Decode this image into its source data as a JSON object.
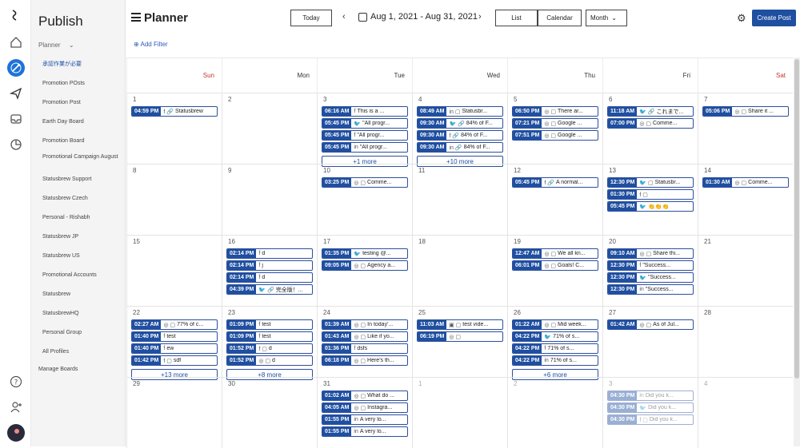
{
  "sidebar": {
    "title": "Publish",
    "section": "Planner",
    "items": [
      "承認作業が必要",
      "Promotion POsts",
      "Promotion Post",
      "Earth Day Board",
      "Promotion Board",
      "Promotional Campaign August",
      "Statusbrew Support",
      "Statusbrew Czech",
      "Personal - Rishabh",
      "Statusbrew JP",
      "Statusbrew US",
      "Promotional Accounts",
      "Statusbrew",
      "StatusbrewHQ",
      "Personal Group",
      "All Profiles"
    ],
    "manage": "Manage Boards"
  },
  "header": {
    "title": "Planner",
    "today": "Today",
    "range": "Aug 1, 2021 - Aug 31, 2021",
    "list": "List",
    "calendar": "Calendar",
    "month": "Month",
    "create": "Create Post",
    "add_filter": "Add Filter"
  },
  "days": [
    "Sun",
    "Mon",
    "Tue",
    "Wed",
    "Thu",
    "Fri",
    "Sat"
  ],
  "weeks": [
    {
      "nums": [
        "1",
        "2",
        "3",
        "4",
        "5",
        "6",
        "7"
      ],
      "cells": [
        {
          "posts": [
            {
              "t": "04:59 PM",
              "i": "f 🔗",
              "x": "Statusbrew"
            }
          ]
        },
        {
          "posts": []
        },
        {
          "posts": [
            {
              "t": "06:16 AM",
              "i": "f",
              "x": "This is a ..."
            },
            {
              "t": "05:45 PM",
              "i": "🐦",
              "x": "\"All progr..."
            },
            {
              "t": "05:45 PM",
              "i": "f",
              "x": "\"All progr..."
            },
            {
              "t": "05:45 PM",
              "i": "in",
              "x": "\"All progr..."
            }
          ],
          "more": "+1 more"
        },
        {
          "posts": [
            {
              "t": "08:49 AM",
              "i": "in ▢",
              "x": "Statusbr..."
            },
            {
              "t": "09:30 AM",
              "i": "🐦 🔗",
              "x": "84% of F..."
            },
            {
              "t": "09:30 AM",
              "i": "f 🔗",
              "x": "84% of F..."
            },
            {
              "t": "09:30 AM",
              "i": "in 🔗",
              "x": "84% of F..."
            }
          ],
          "more": "+10 more"
        },
        {
          "posts": [
            {
              "t": "06:50 PM",
              "i": "◎ ▢",
              "x": "There ar..."
            },
            {
              "t": "07:21 PM",
              "i": "◎ ▢",
              "x": "Google ..."
            },
            {
              "t": "07:51 PM",
              "i": "◎ ▢",
              "x": "Google ..."
            }
          ]
        },
        {
          "posts": [
            {
              "t": "11:18 AM",
              "i": "🐦 🔗",
              "x": "これまで..."
            },
            {
              "t": "07:00 PM",
              "i": "◎ ▢",
              "x": "Comme..."
            }
          ]
        },
        {
          "posts": [
            {
              "t": "05:06 PM",
              "i": "◎ ▢",
              "x": "Share it ..."
            }
          ]
        }
      ]
    },
    {
      "nums": [
        "8",
        "9",
        "10",
        "11",
        "12",
        "13",
        "14"
      ],
      "cells": [
        {
          "posts": []
        },
        {
          "posts": []
        },
        {
          "posts": [
            {
              "t": "03:25 PM",
              "i": "◎ ▢",
              "x": "Comme..."
            }
          ]
        },
        {
          "posts": []
        },
        {
          "posts": [
            {
              "t": "05:45 PM",
              "i": "f 🔗",
              "x": "A normal..."
            }
          ]
        },
        {
          "posts": [
            {
              "t": "12:30 PM",
              "i": "🐦 ▢",
              "x": "Statusbr..."
            },
            {
              "t": "01:30 PM",
              "i": "f ▢",
              "x": ""
            },
            {
              "t": "05:45 PM",
              "i": "🐦",
              "x": "👏👏👏"
            }
          ]
        },
        {
          "posts": [
            {
              "t": "01:30 AM",
              "i": "◎ ▢",
              "x": "Comme..."
            }
          ]
        }
      ]
    },
    {
      "nums": [
        "15",
        "16",
        "17",
        "18",
        "19",
        "20",
        "21"
      ],
      "cells": [
        {
          "posts": []
        },
        {
          "posts": [
            {
              "t": "02:14 PM",
              "i": "f",
              "x": "d"
            },
            {
              "t": "02:14 PM",
              "i": "f",
              "x": "j"
            },
            {
              "t": "02:14 PM",
              "i": "f",
              "x": "d"
            },
            {
              "t": "04:39 PM",
              "i": "🐦 🔗",
              "x": "完全版！..."
            }
          ]
        },
        {
          "posts": [
            {
              "t": "01:35 PM",
              "i": "🐦",
              "x": "testing @..."
            },
            {
              "t": "09:05 PM",
              "i": "◎ ▢",
              "x": "Agency a..."
            }
          ]
        },
        {
          "posts": []
        },
        {
          "posts": [
            {
              "t": "12:47 AM",
              "i": "◎ ▢",
              "x": "We all kn..."
            },
            {
              "t": "06:01 PM",
              "i": "◎ ▢",
              "x": "Goals! C..."
            }
          ]
        },
        {
          "posts": [
            {
              "t": "09:10 AM",
              "i": "◎ ▢",
              "x": "Share thi..."
            },
            {
              "t": "12:30 PM",
              "i": "f",
              "x": "\"Success..."
            },
            {
              "t": "12:30 PM",
              "i": "🐦",
              "x": "\"Success..."
            },
            {
              "t": "12:30 PM",
              "i": "in",
              "x": "\"Success..."
            }
          ]
        },
        {
          "posts": []
        }
      ]
    },
    {
      "nums": [
        "22",
        "23",
        "24",
        "25",
        "26",
        "27",
        "28"
      ],
      "cells": [
        {
          "posts": [
            {
              "t": "02:27 AM",
              "i": "◎ ▢",
              "x": "77% of c..."
            },
            {
              "t": "01:40 PM",
              "i": "f",
              "x": "test"
            },
            {
              "t": "01:40 PM",
              "i": "f",
              "x": "ew"
            },
            {
              "t": "01:42 PM",
              "i": "f ▢",
              "x": "sdf"
            }
          ],
          "more": "+13 more"
        },
        {
          "posts": [
            {
              "t": "01:09 PM",
              "i": "f",
              "x": "test"
            },
            {
              "t": "01:09 PM",
              "i": "f",
              "x": "test"
            },
            {
              "t": "01:52 PM",
              "i": "f ▢",
              "x": "d"
            },
            {
              "t": "01:52 PM",
              "i": "◎ ▢",
              "x": "d"
            }
          ],
          "more": "+8 more"
        },
        {
          "posts": [
            {
              "t": "01:39 AM",
              "i": "◎ ▢",
              "x": "In today'..."
            },
            {
              "t": "01:43 AM",
              "i": "◎ ▢",
              "x": "Like if yo..."
            },
            {
              "t": "01:36 PM",
              "i": "f",
              "x": "dsfs"
            },
            {
              "t": "06:18 PM",
              "i": "◎ ▢",
              "x": "Here's th..."
            }
          ]
        },
        {
          "posts": [
            {
              "t": "11:03 AM",
              "i": "▣ ▢",
              "x": "test vide..."
            },
            {
              "t": "06:19 PM",
              "i": "◎ ▢",
              "x": ""
            }
          ]
        },
        {
          "posts": [
            {
              "t": "01:22 AM",
              "i": "◎ ▢",
              "x": "Mid week..."
            },
            {
              "t": "04:22 PM",
              "i": "🐦",
              "x": "71% of s..."
            },
            {
              "t": "04:22 PM",
              "i": "f",
              "x": "71% of s..."
            },
            {
              "t": "04:22 PM",
              "i": "in",
              "x": "71% of s..."
            }
          ],
          "more": "+6 more"
        },
        {
          "posts": [
            {
              "t": "01:42 AM",
              "i": "◎ ▢",
              "x": "As of Jul..."
            }
          ]
        },
        {
          "posts": []
        }
      ]
    },
    {
      "nums": [
        "29",
        "30",
        "31",
        "1",
        "2",
        "3",
        "4"
      ],
      "cells": [
        {
          "posts": []
        },
        {
          "posts": []
        },
        {
          "posts": [
            {
              "t": "01:02 AM",
              "i": "◎ ▢",
              "x": "What do ..."
            },
            {
              "t": "04:05 AM",
              "i": "◎ ▢",
              "x": "Instagra..."
            },
            {
              "t": "01:55 PM",
              "i": "in",
              "x": "A very lo..."
            },
            {
              "t": "01:55 PM",
              "i": "in",
              "x": "A very lo..."
            }
          ]
        },
        {
          "posts": []
        },
        {
          "posts": []
        },
        {
          "posts": [
            {
              "t": "04:30 PM",
              "i": "in",
              "x": "Did you k..."
            },
            {
              "t": "04:30 PM",
              "i": "🐦",
              "x": "Did you k..."
            },
            {
              "t": "04:30 PM",
              "i": "f ▢",
              "x": "Did you k..."
            }
          ],
          "faded": true
        },
        {
          "posts": []
        }
      ]
    }
  ]
}
